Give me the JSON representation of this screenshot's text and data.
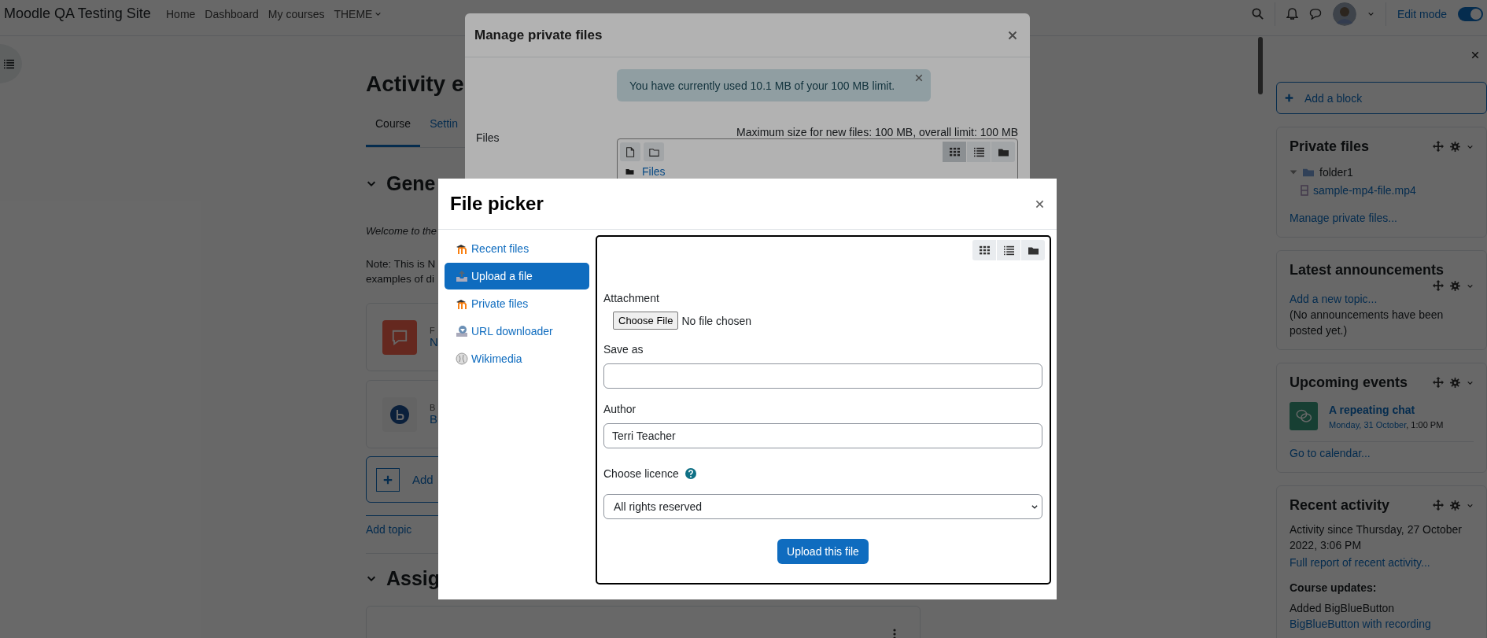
{
  "navbar": {
    "site_name": "Moodle QA Testing Site",
    "links": [
      {
        "label": "Home",
        "dropdown": false
      },
      {
        "label": "Dashboard",
        "dropdown": false
      },
      {
        "label": "My courses",
        "dropdown": false
      },
      {
        "label": "THEME",
        "dropdown": true
      }
    ],
    "edit_mode": {
      "label": "Edit mode",
      "on": true
    }
  },
  "course": {
    "title": "Activity e",
    "tabs": [
      {
        "label": "Course",
        "selected": true
      },
      {
        "label": "Settin",
        "selected": false
      }
    ],
    "general": {
      "title": "Gene",
      "intro": "Welcome to the",
      "note_lines": [
        "Note: This is N",
        "examples of di"
      ],
      "activities": [
        {
          "kind": "forum",
          "type": "F",
          "name": "N"
        },
        {
          "kind": "bigbluebutton",
          "type": "B",
          "name": "B"
        }
      ],
      "add_activity": "Add"
    },
    "add_topic": "Add topic",
    "next_section": {
      "title": "Assig"
    }
  },
  "blocks": {
    "add_block": "Add a block",
    "items": [
      {
        "kind": "tree",
        "title": "Private files",
        "tree": [
          {
            "label": "folder1",
            "kind": "folder",
            "expanded": true,
            "children": [
              {
                "label": "sample-mp4-file.mp4",
                "kind": "file"
              }
            ]
          }
        ],
        "link": "Manage private files..."
      },
      {
        "kind": "announcements",
        "title": "Latest announcements",
        "link": "Add a new topic...",
        "note": "(No announcements have been posted yet.)"
      },
      {
        "kind": "events",
        "title": "Upcoming events",
        "events": [
          {
            "name": "A repeating chat",
            "date": "Monday, 31 October",
            "time": ", 1:00 PM"
          }
        ],
        "link": "Go to calendar..."
      },
      {
        "kind": "activity",
        "title": "Recent activity",
        "since": "Activity since Thursday, 27 October 2022, 3:06 PM",
        "link": "Full report of recent activity...",
        "updates_heading": "Course updates:",
        "update": "Added BigBlueButton",
        "update_link": "BigBlueButton with recording"
      }
    ]
  },
  "manage_files": {
    "title": "Manage private files",
    "alert": "You have currently used 10.1 MB of your 100 MB limit.",
    "files_label": "Files",
    "limits": "Maximum size for new files: 100 MB, overall limit: 100 MB",
    "view_modes": [
      {
        "kind": "icons",
        "selected": true
      },
      {
        "kind": "list",
        "selected": false
      },
      {
        "kind": "tree",
        "selected": false
      }
    ],
    "path": "Files"
  },
  "file_picker": {
    "title": "File picker",
    "repositories": [
      {
        "kind": "moodle",
        "label": "Recent files",
        "selected": false
      },
      {
        "kind": "upload",
        "label": "Upload a file",
        "selected": true
      },
      {
        "kind": "moodle",
        "label": "Private files",
        "selected": false
      },
      {
        "kind": "url",
        "label": "URL downloader",
        "selected": false
      },
      {
        "kind": "wikimedia",
        "label": "Wikimedia",
        "selected": false
      }
    ],
    "view_modes": [
      {
        "kind": "icons"
      },
      {
        "kind": "list"
      },
      {
        "kind": "tree"
      }
    ],
    "attachment": {
      "label": "Attachment",
      "button": "Choose File",
      "status": "No file chosen"
    },
    "save_as": {
      "label": "Save as"
    },
    "author": {
      "label": "Author",
      "value": "Terri Teacher"
    },
    "licence": {
      "label": "Choose licence",
      "value": "All rights reserved"
    },
    "submit": "Upload this file"
  }
}
